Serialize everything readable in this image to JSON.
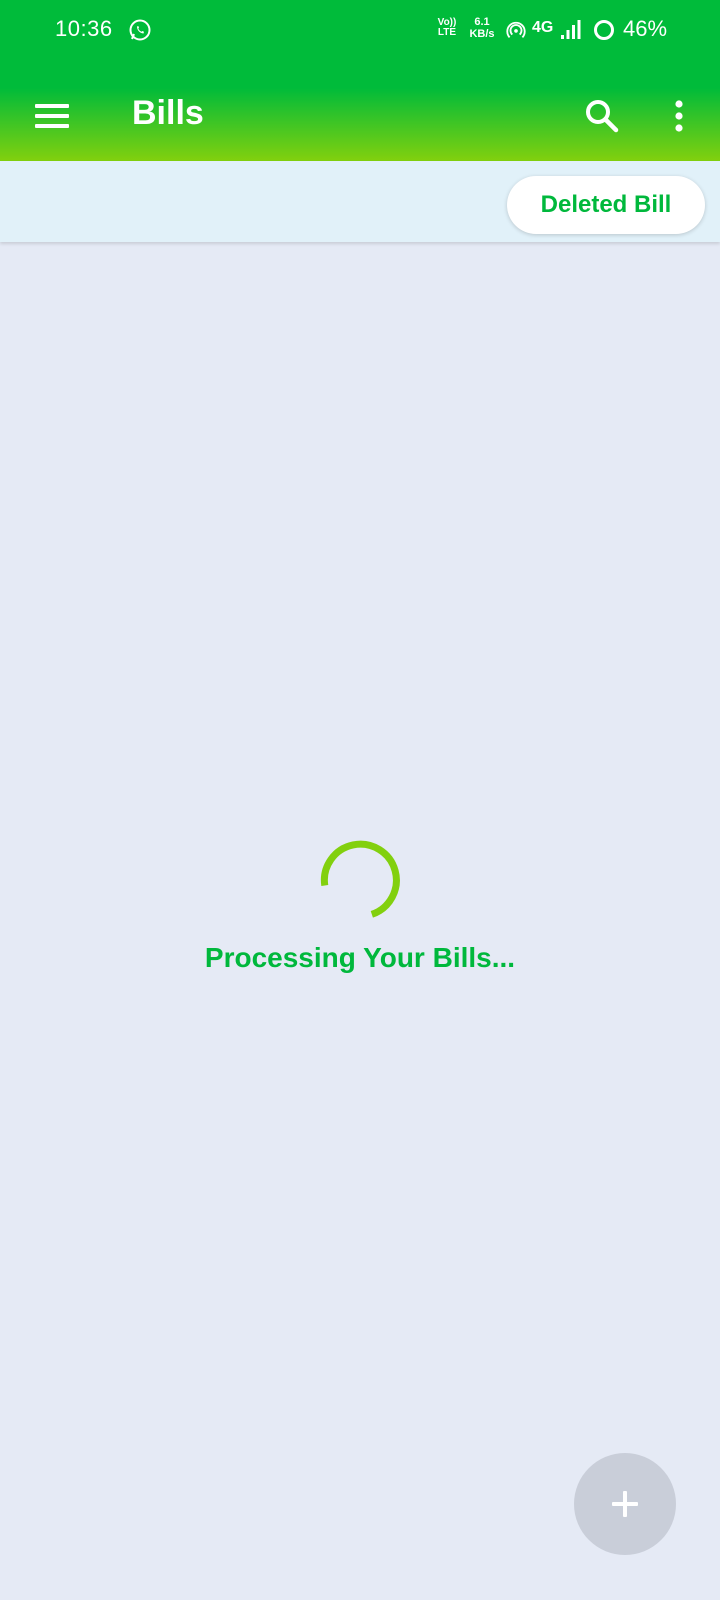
{
  "status_bar": {
    "time": "10:36",
    "volte_line1": "Vo))",
    "volte_line2": "LTE",
    "speed_value": "6.1",
    "speed_unit": "KB/s",
    "network": "4G",
    "battery": "46%",
    "icons": [
      "whatsapp-icon",
      "hotspot-icon",
      "signal-icon",
      "battery-ring-icon"
    ]
  },
  "app_bar": {
    "title": "Bills",
    "icons": [
      "menu-icon",
      "search-icon",
      "more-vert-icon"
    ]
  },
  "filter": {
    "deleted_label": "Deleted Bill"
  },
  "loading": {
    "message": "Processing Your Bills..."
  },
  "fab": {
    "icon": "plus-icon"
  },
  "colors": {
    "primary_green": "#00bb3a",
    "accent_lime": "#82d00e",
    "text_green": "#00b83c",
    "background": "#e5eaf5",
    "strip_background": "#e1f1f9",
    "fab_disabled": "#c9ced9"
  }
}
